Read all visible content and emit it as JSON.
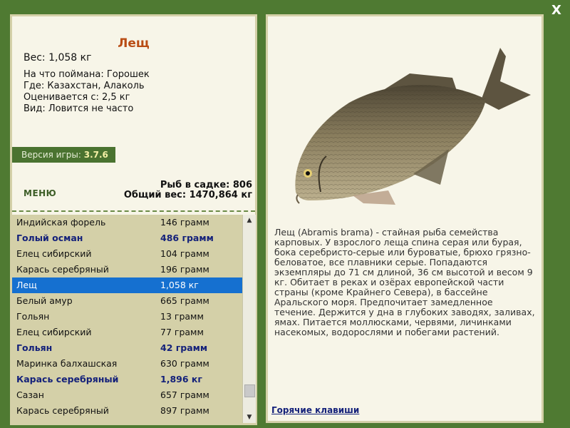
{
  "close_glyph": "X",
  "fish": {
    "title": "Лещ",
    "weight": "Вес: 1,058 кг",
    "caught_on": "На что поймана: Горошек",
    "location": "Где: Казахстан, Алаколь",
    "rated_from": "Оценивается с: 2,5 кг",
    "rarity": "Вид: Ловится не часто"
  },
  "version": {
    "label": "Версия игры: ",
    "value": "3.7.6"
  },
  "menu_label": "МЕНЮ",
  "stats": {
    "fish_count": "Рыб в садке: 806",
    "total_weight": "Общий вес: 1470,864 кг"
  },
  "catch_list": [
    {
      "name": "Индийская форель",
      "weight": "146 грамм",
      "style": "normal"
    },
    {
      "name": "Голый осман",
      "weight": "486 грамм",
      "style": "bold"
    },
    {
      "name": "Елец сибирский",
      "weight": "104 грамм",
      "style": "normal"
    },
    {
      "name": "Карась серебряный",
      "weight": "196 грамм",
      "style": "normal"
    },
    {
      "name": "Лещ",
      "weight": "1,058 кг",
      "style": "selected"
    },
    {
      "name": "Белый амур",
      "weight": "665 грамм",
      "style": "normal"
    },
    {
      "name": "Гольян",
      "weight": "13 грамм",
      "style": "normal"
    },
    {
      "name": "Елец сибирский",
      "weight": "77 грамм",
      "style": "normal"
    },
    {
      "name": "Гольян",
      "weight": "42 грамм",
      "style": "bold"
    },
    {
      "name": "Маринка балхашская",
      "weight": "630 грамм",
      "style": "normal"
    },
    {
      "name": "Карась серебряный",
      "weight": "1,896 кг",
      "style": "bold"
    },
    {
      "name": "Сазан",
      "weight": "657 грамм",
      "style": "normal"
    },
    {
      "name": "Карась серебряный",
      "weight": "897 грамм",
      "style": "normal"
    }
  ],
  "description": "Лещ (Abramis brama) - стайная рыба семейства карповых. У взрослого леща спина серая или бурая, бока серебристо-серые или буроватые, брюхо грязно-беловатое, все плавники серые. Попадаются экземпляры до 71 см длиной, 36 см высотой и весом 9 кг. Обитает в реках и озёрах европейской части страны (кроме Крайнего Севера), в бассейне Аральского моря. Предпочитает замедленное течение. Держится у дна в глубоких заводях, заливах, ямах. Питается моллюсками, червями, личинками насекомых, водорослями и побегами растений.",
  "hotkeys_label": "Горячие клавиши",
  "colors": {
    "background": "#4f7a32",
    "panel": "#f7f5e8",
    "list_bg": "#d4d0a8",
    "selected": "#1570d0",
    "bold_row": "#14217a",
    "title": "#b94c14"
  }
}
